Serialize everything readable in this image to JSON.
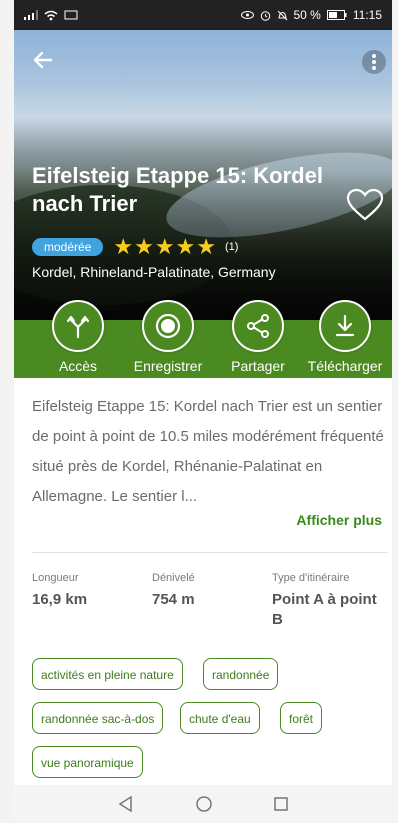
{
  "status_bar": {
    "battery": "50 %",
    "time": "11:15"
  },
  "hero": {
    "title": "Eifelsteig Etappe 15: Kordel nach Trier",
    "difficulty": "modérée",
    "stars": "★★★★★",
    "rating_count": "(1)",
    "location": "Kordel, Rhineland-Palatinate, Germany"
  },
  "actions": [
    {
      "label": "Accès",
      "icon": "directions-icon"
    },
    {
      "label": "Enregistrer",
      "icon": "record-icon"
    },
    {
      "label": "Partager",
      "icon": "share-icon"
    },
    {
      "label": "Télécharger",
      "icon": "download-icon"
    }
  ],
  "description": {
    "text": "Eifelsteig Etappe 15: Kordel nach Trier est un sentier de point à point de 10.5 miles modérément fréquenté situé près de Kordel, Rhénanie-Palatinat en Allemagne. Le sentier l...",
    "more": "Afficher plus"
  },
  "stats": {
    "length_label": "Longueur",
    "length_value": "16,9 km",
    "elevation_label": "Dénivelé",
    "elevation_value": "754 m",
    "route_label": "Type d'itinéraire",
    "route_value": "Point A à point B"
  },
  "tags": [
    "activités en pleine nature",
    "randonnée",
    "randonnée sac-à-dos",
    "chute d'eau",
    "forêt",
    "vue panoramique"
  ],
  "colors": {
    "brand_green": "#4a8a21",
    "badge_blue": "#3fa3e0",
    "star_yellow": "#f6cc1f"
  }
}
